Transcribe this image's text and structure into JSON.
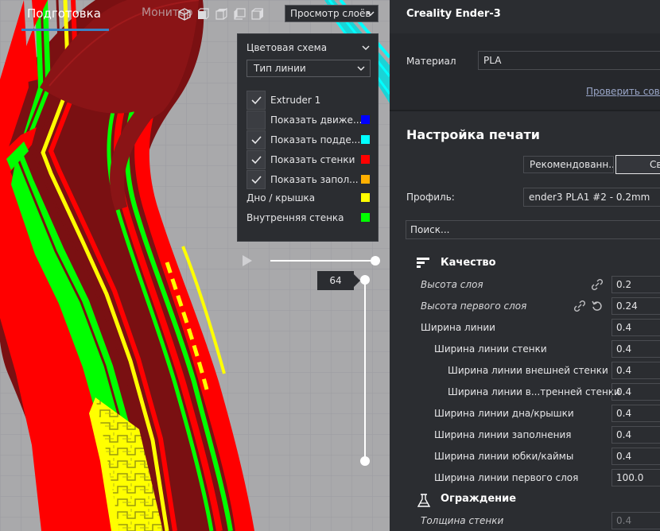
{
  "topbar": {
    "tab_prepare": "Подготовка",
    "tab_monitor": "Монитор",
    "view_select": "Просмотр слоёв"
  },
  "scheme_panel": {
    "title": "Цветовая схема",
    "line_type": "Тип линии",
    "items": [
      {
        "label": "Extruder 1",
        "checked": true,
        "color": ""
      },
      {
        "label": "Показать движе...",
        "checked": false,
        "color": "#0000ff"
      },
      {
        "label": "Показать подде...",
        "checked": true,
        "color": "#00ffff"
      },
      {
        "label": "Показать стенки",
        "checked": true,
        "color": "#ff0000"
      },
      {
        "label": "Показать запол...",
        "checked": true,
        "color": "#ffb000"
      }
    ],
    "legend": [
      {
        "label": "Дно / крышка",
        "color": "#ffff00"
      },
      {
        "label": "Внутренняя стенка",
        "color": "#00ff00"
      }
    ]
  },
  "layer_slider": {
    "current_layer": "64"
  },
  "right_panel": {
    "printer": "Creality Ender-3",
    "material_label": "Материал",
    "material_value": "PLA",
    "compat_link": "Проверить совм",
    "print_setup_title": "Настройка печати",
    "mode_recommended": "Рекомендованн...",
    "mode_custom": "Св",
    "profile_label": "Профиль:",
    "profile_value": "ender3 PLA1 #2 - 0.2mm",
    "search_placeholder": "Поиск...",
    "cat_quality": "Качество",
    "cat_walls": "Ограждение",
    "settings": [
      {
        "label": "Высота слоя",
        "value": "0.2"
      },
      {
        "label": "Высота первого слоя",
        "value": "0.24"
      },
      {
        "label": "Ширина линии",
        "value": "0.4"
      },
      {
        "label": "Ширина линии стенки",
        "value": "0.4"
      },
      {
        "label": "Ширина линии внешней стенки",
        "value": "0.4"
      },
      {
        "label": "Ширина линии в...тренней стенки",
        "value": "0.4"
      },
      {
        "label": "Ширина линии дна/крышки",
        "value": "0.4"
      },
      {
        "label": "Ширина линии заполнения",
        "value": "0.4"
      },
      {
        "label": "Ширина линии юбки/каймы",
        "value": "0.4"
      },
      {
        "label": "Ширина линии первого слоя",
        "value": "100.0"
      },
      {
        "label": "Толщина стенки",
        "value": "0.4"
      }
    ]
  },
  "colors": {
    "accent": "#3b82c4",
    "panel_bg": "#2b2d31",
    "wall_red": "#ff0000",
    "inner_green": "#00ff00",
    "top_yellow": "#ffff00",
    "support_cyan": "#00ffff",
    "travel_blue": "#0000ff",
    "infill_orange": "#ffb000"
  }
}
